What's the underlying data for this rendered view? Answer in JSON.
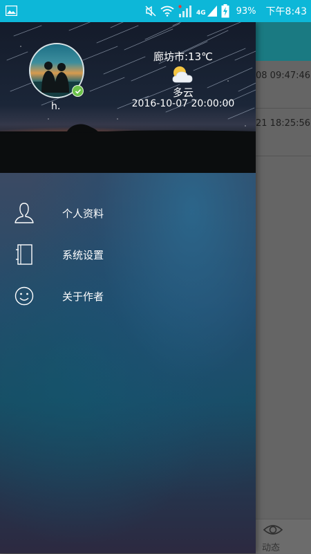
{
  "status_bar": {
    "battery_percent": "93%",
    "network": "4G",
    "time": "下午8:43",
    "icons": [
      "image-notification-icon",
      "mute-icon",
      "wifi-icon",
      "signal-icon",
      "battery-charging-icon"
    ]
  },
  "drawer": {
    "profile": {
      "username": "h.",
      "online": true
    },
    "weather": {
      "city_temp": "廊坊市:13℃",
      "condition": "多云",
      "time": "2016-10-07 20:00:00",
      "icon": "partly-cloudy-icon"
    },
    "menu": [
      {
        "label": "个人资料",
        "icon": "person-icon"
      },
      {
        "label": "系统设置",
        "icon": "notebook-icon"
      },
      {
        "label": "关于作者",
        "icon": "smiley-icon"
      }
    ]
  },
  "background_screen": {
    "rows": [
      {
        "time": "08 09:47:46"
      },
      {
        "time": "21 18:25:56"
      }
    ],
    "bottom_tab": {
      "label": "动态",
      "icon": "eye-icon"
    }
  },
  "colors": {
    "status_bar": "#0db7d8",
    "app_bar": "#1a7a82",
    "online_badge": "#6cc24a"
  }
}
